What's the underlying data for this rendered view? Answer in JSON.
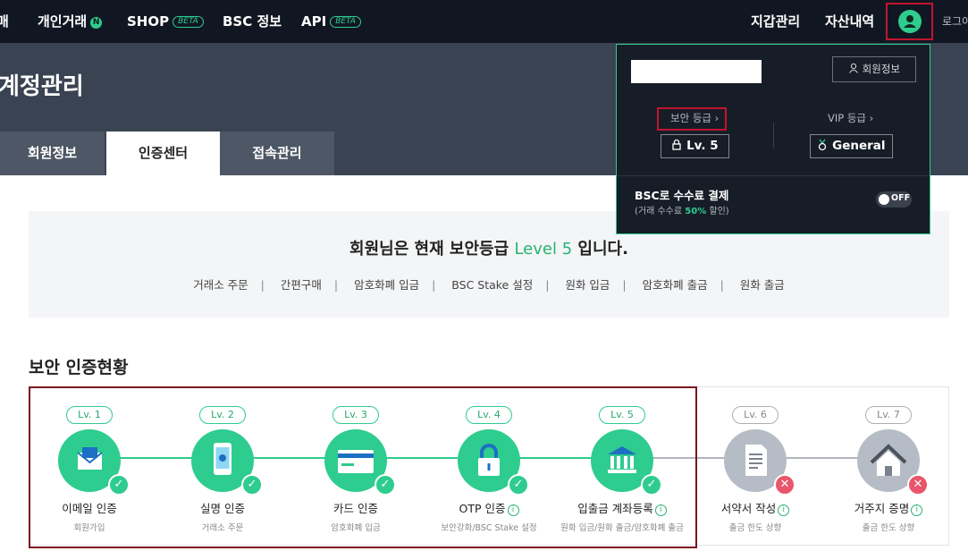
{
  "nav": {
    "left_items": [
      {
        "label": "매"
      },
      {
        "label": "개인거래",
        "badge": "N"
      },
      {
        "label": "SHOP",
        "badge": "BETA"
      },
      {
        "label": "BSC 정보"
      },
      {
        "label": "API",
        "badge": "BETA"
      }
    ],
    "wallet": "지갑관리",
    "assets": "자산내역",
    "login": "로그아",
    "user_icon": "user-icon"
  },
  "page": {
    "title": "계정관리",
    "tabs": [
      "회원정보",
      "인증센터",
      "접속관리"
    ],
    "active_tab": "인증센터"
  },
  "info": {
    "title_pre": "회원님은 현재 보안등급",
    "level_text": "Level 5",
    "title_post": "입니다.",
    "links": [
      "거래소 주문",
      "간편구매",
      "암호화폐 입금",
      "BSC Stake 설정",
      "원화 입금",
      "암호화폐 출금",
      "원화 출금"
    ]
  },
  "section_title": "보안 인증현황",
  "steps": [
    {
      "level": "Lv. 1",
      "name": "이메일 인증",
      "sub": "회원가입",
      "done": true,
      "icon": "envelope-icon",
      "info": false
    },
    {
      "level": "Lv. 2",
      "name": "실명 인증",
      "sub": "거래소 주문",
      "done": true,
      "icon": "phone-icon",
      "info": false
    },
    {
      "level": "Lv. 3",
      "name": "카드 인증",
      "sub": "암호화폐 입금",
      "done": true,
      "icon": "card-icon",
      "info": false
    },
    {
      "level": "Lv. 4",
      "name": "OTP 인증",
      "sub": "보안강화/BSC Stake 설정",
      "done": true,
      "icon": "lock-icon",
      "info": true
    },
    {
      "level": "Lv. 5",
      "name": "입출금 계좌등록",
      "sub": "원화 입금/원화 출금/암호화폐 출금",
      "done": true,
      "icon": "bank-icon",
      "info": true
    },
    {
      "level": "Lv. 6",
      "name": "서약서 작성",
      "sub": "출금 한도 상향",
      "done": false,
      "icon": "document-icon",
      "info": true
    },
    {
      "level": "Lv. 7",
      "name": "거주지 증명",
      "sub": "출금 한도 상향",
      "done": false,
      "icon": "house-icon",
      "info": true
    }
  ],
  "dropdown": {
    "member_info_btn": "회원정보",
    "security_label": "보안 등급",
    "security_value": "Lv. 5",
    "vip_label": "VIP 등급",
    "vip_value": "General",
    "bsc_title": "BSC로 수수료 결제",
    "bsc_sub_pre": "(거래 수수료",
    "bsc_pct": "50%",
    "bsc_sub_post": "할인)",
    "toggle": "OFF"
  },
  "colors": {
    "accent": "#2ecc8f",
    "nav_bg": "#111722",
    "subhead_bg": "#3a4352",
    "highlight": "#c0152f"
  }
}
